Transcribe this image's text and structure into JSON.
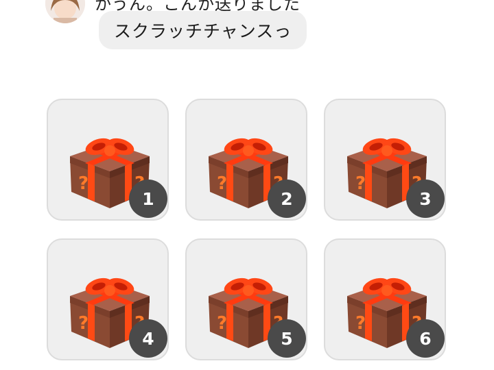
{
  "chat": {
    "partial_message": "かうん。こんか送りました",
    "message": "スクラッチチャンスっ"
  },
  "scratch_cards": [
    {
      "number": "1"
    },
    {
      "number": "2"
    },
    {
      "number": "3"
    },
    {
      "number": "4"
    },
    {
      "number": "5"
    },
    {
      "number": "6"
    }
  ],
  "colors": {
    "bubble_bg": "#efefef",
    "card_bg": "#efefef",
    "card_border": "#dcdcdc",
    "badge_bg": "#4a4a4a",
    "box_brown": "#8a4a33",
    "ribbon": "#ff4a14",
    "question_mark": "#ff7a2a"
  },
  "icons": {
    "avatar": "character-avatar",
    "card": "mystery-gift-box-icon"
  }
}
